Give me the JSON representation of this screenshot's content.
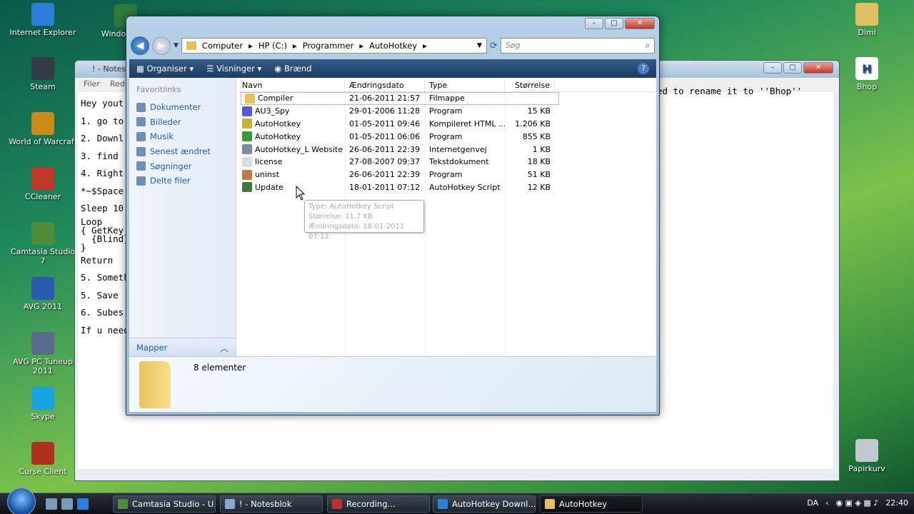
{
  "desktop_left": [
    {
      "label": "Internet Explorer",
      "color": "#2b7fd8"
    },
    {
      "label": "Steam",
      "color": "#333b44"
    },
    {
      "label": "World of Warcraft",
      "color": "#c98a1a"
    },
    {
      "label": "CCleaner",
      "color": "#c0392b"
    },
    {
      "label": "Camtasia Studio 7",
      "color": "#4e8d3a"
    },
    {
      "label": "AVG 2011",
      "color": "#2a5ab0"
    },
    {
      "label": "AVG PC Tuneup 2011",
      "color": "#5a6a8a"
    },
    {
      "label": "Skype",
      "color": "#17a3e0"
    },
    {
      "label": "Curse Client",
      "color": "#b03020"
    }
  ],
  "desktop_left2": {
    "label": "Windows Media Center",
    "short": "Window Cen"
  },
  "desktop_right": [
    {
      "label": "Dimi",
      "color": "#e0c060"
    },
    {
      "label": "Bhop",
      "color": "#ffffff"
    },
    {
      "label": "Papirkurv",
      "color": "#c0c8d0"
    }
  ],
  "notepad": {
    "title": "! - Notesblok",
    "title_short": "! - Notes",
    "menu": [
      "Filer",
      "Redi"
    ],
    "lines": [
      "Hey yout",
      "1. go to",
      "2. Downl",
      "3. find",
      "4. Right",
      "*~$Space",
      "Sleep 10",
      "Loop",
      "{ GetKey",
      "  {Blind}",
      "}",
      "Return",
      "5. Someth",
      "5. Save",
      "6. Subes",
      "If u need"
    ],
    "right_text": "ed to rename it to ''Bhop''"
  },
  "explorer": {
    "breadcrumb": [
      "Computer",
      "HP (C:)",
      "Programmer",
      "AutoHotkey"
    ],
    "search_placeholder": "Søg",
    "toolbar": {
      "organize": "Organiser",
      "views": "Visninger",
      "burn": "Brænd"
    },
    "nav": {
      "header": "Favoritlinks",
      "links": [
        "Dokumenter",
        "Billeder",
        "Musik",
        "Senest ændret",
        "Søgninger",
        "Delte filer"
      ],
      "folders_label": "Mapper"
    },
    "columns": [
      "Navn",
      "Ændringsdato",
      "Type",
      "Størrelse"
    ],
    "files": [
      {
        "name": "Compiler",
        "date": "21-06-2011 21:57",
        "type": "Filmappe",
        "size": "",
        "icon_color": "#e6c25a"
      },
      {
        "name": "AU3_Spy",
        "date": "29-01-2006 11:28",
        "type": "Program",
        "size": "15 KB",
        "icon_color": "#5a5ad0"
      },
      {
        "name": "AutoHotkey",
        "date": "01-05-2011 09:46",
        "type": "Kompileret HTML ...",
        "size": "1.206 KB",
        "icon_color": "#c8b030"
      },
      {
        "name": "AutoHotkey",
        "date": "01-05-2011 06:06",
        "type": "Program",
        "size": "855 KB",
        "icon_color": "#3a9a3a"
      },
      {
        "name": "AutoHotkey_L Website",
        "date": "26-06-2011 22:39",
        "type": "Internetgenvej",
        "size": "1 KB",
        "icon_color": "#7a8aa8"
      },
      {
        "name": "license",
        "date": "27-08-2007 09:37",
        "type": "Tekstdokument",
        "size": "18 KB",
        "icon_color": "#d8dde4"
      },
      {
        "name": "uninst",
        "date": "26-06-2011 22:39",
        "type": "Program",
        "size": "51 KB",
        "icon_color": "#c07a40"
      },
      {
        "name": "Update",
        "date": "18-01-2011 07:12",
        "type": "AutoHotkey Script",
        "size": "12 KB",
        "icon_color": "#3a7a3a"
      }
    ],
    "tooltip": {
      "type": "Type: AutoHotkey Script",
      "size": "Størrelse: 11,7 KB",
      "date": "Ændringsdato: 18-01-2011 07:12"
    },
    "detail": {
      "count": "8 elementer"
    }
  },
  "taskbar": {
    "buttons": [
      {
        "label": "Camtasia Studio - U...",
        "color": "#4e8d3a"
      },
      {
        "label": "! - Notesblok",
        "color": "#8aa8c8"
      },
      {
        "label": "Recording...",
        "color": "#c03030"
      },
      {
        "label": "AutoHotkey Downl...",
        "color": "#2b7fd8"
      },
      {
        "label": "AutoHotkey",
        "color": "#e6c25a"
      }
    ],
    "language": "DA",
    "clock": "22:40"
  }
}
